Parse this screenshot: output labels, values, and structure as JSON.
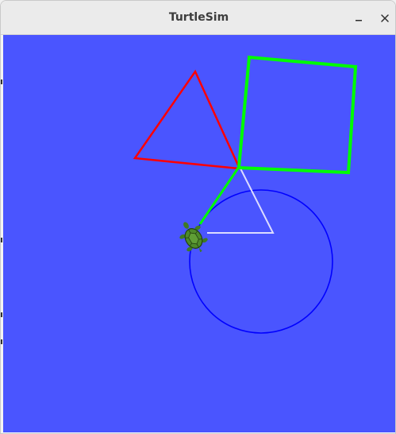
{
  "window": {
    "title": "TurtleSim"
  },
  "controls": {
    "minimize_icon": "minimize-icon",
    "close_icon": "close-icon"
  },
  "canvas": {
    "background_color": "#4a55ff",
    "turtle_icon": "turtle-icon",
    "trails": [
      {
        "name": "red-triangle-trail",
        "color": "#ff0000"
      },
      {
        "name": "green-square-trail",
        "color": "#00ff00"
      },
      {
        "name": "green-connector-trail",
        "color": "#00ff00"
      },
      {
        "name": "white-triangle-trail",
        "color": "#dcdcff"
      },
      {
        "name": "blue-circle-trail",
        "color": "#0000ff"
      }
    ]
  }
}
